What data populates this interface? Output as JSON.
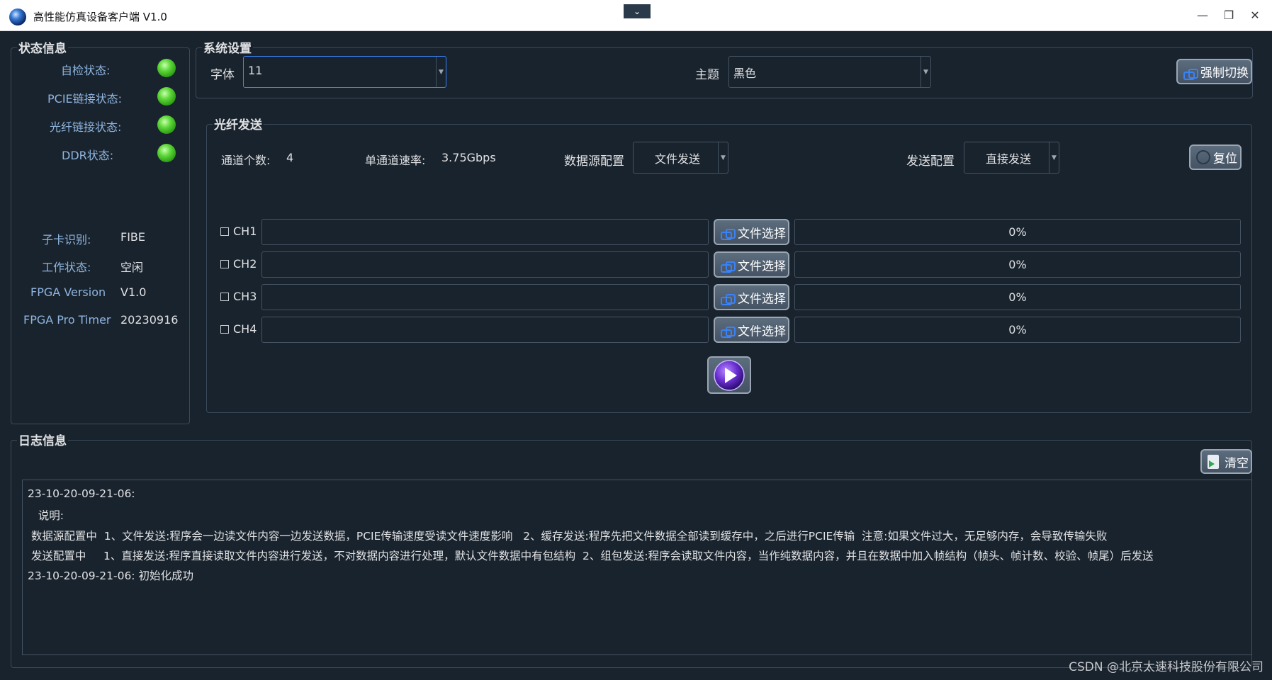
{
  "window": {
    "title": "高性能仿真设备客户端 V1.0",
    "minimize_icon": "minimize-icon",
    "maximize_icon": "restore-icon",
    "close_icon": "close-icon"
  },
  "status_panel": {
    "title": "状态信息",
    "items": [
      {
        "label": "自检状态:",
        "state": "ok"
      },
      {
        "label": "PCIE链接状态:",
        "state": "ok"
      },
      {
        "label": "光纤链接状态:",
        "state": "ok"
      },
      {
        "label": "DDR状态:",
        "state": "ok"
      }
    ],
    "info": [
      {
        "label": "子卡识别:",
        "value": "FIBE"
      },
      {
        "label": "工作状态:",
        "value": "空闲"
      },
      {
        "label": "FPGA Version",
        "value": "V1.0"
      },
      {
        "label": "FPGA Pro Timer",
        "value": "20230916"
      }
    ]
  },
  "system_settings": {
    "title": "系统设置",
    "font_label": "字体",
    "font_value": "11",
    "theme_label": "主题",
    "theme_value": "黑色",
    "force_switch_label": "强制切换"
  },
  "fiber_send": {
    "title": "光纤发送",
    "channel_count_label": "通道个数:",
    "channel_count_value": "4",
    "rate_label": "单通道速率:",
    "rate_value": "3.75Gbps",
    "source_label": "数据源配置",
    "source_value": "文件发送",
    "send_config_label": "发送配置",
    "send_config_value": "直接发送",
    "reset_label": "复位",
    "channels": [
      {
        "name": "CH1",
        "path": "",
        "button": "文件选择",
        "progress": "0%"
      },
      {
        "name": "CH2",
        "path": "",
        "button": "文件选择",
        "progress": "0%"
      },
      {
        "name": "CH3",
        "path": "",
        "button": "文件选择",
        "progress": "0%"
      },
      {
        "name": "CH4",
        "path": "",
        "button": "文件选择",
        "progress": "0%"
      }
    ]
  },
  "log": {
    "title": "日志信息",
    "clear_label": "清空",
    "lines": [
      "23-10-20-09-21-06:",
      "   说明:",
      " 数据源配置中  1、文件发送:程序会一边读文件内容一边发送数据，PCIE传输速度受读文件速度影响   2、缓存发送:程序先把文件数据全部读到缓存中，之后进行PCIE传输  注意:如果文件过大，无足够内存，会导致传输失败",
      " 发送配置中     1、直接发送:程序直接读取文件内容进行发送，不对数据内容进行处理，默认文件数据中有包结构  2、组包发送:程序会读取文件内容，当作纯数据内容，并且在数据中加入帧结构（帧头、帧计数、校验、帧尾）后发送",
      "23-10-20-09-21-06: 初始化成功"
    ]
  },
  "watermark": "CSDN @北京太速科技股份有限公司",
  "colors": {
    "background": "#19232d",
    "border": "#455364",
    "label_blue": "#8fb5e0",
    "led_green": "#5fd83a",
    "play_purple": "#6a2fd1"
  }
}
